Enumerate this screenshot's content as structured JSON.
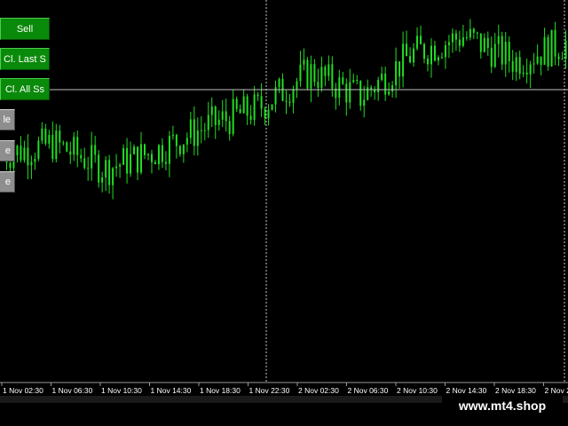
{
  "buttons": {
    "sell_label": "Sell",
    "close_last_label": "Cl. Last S",
    "close_all_label": "Cl. All Ss",
    "grey_1_label": "le",
    "grey_2_label": "e",
    "grey_3_label": "e"
  },
  "time_axis": {
    "labels": [
      "1 Nov 02:30",
      "1 Nov 06:30",
      "1 Nov 10:30",
      "1 Nov 14:30",
      "1 Nov 18:30",
      "1 Nov 22:30",
      "2 Nov 02:30",
      "2 Nov 06:30",
      "2 Nov 10:30",
      "2 Nov 14:30",
      "2 Nov 18:30",
      "2 Nov 2"
    ]
  },
  "watermark": "www.mt4.shop",
  "colors": {
    "background": "#000000",
    "candle": "#22dd22",
    "grid": "#c0c0c0",
    "button_green": "#0a8a0a",
    "button_grey": "#8e8e8e",
    "text": "#ffffff"
  },
  "chart_data": {
    "type": "line",
    "x_labels": [
      "1 Nov 02:30",
      "1 Nov 06:30",
      "1 Nov 10:30",
      "1 Nov 14:30",
      "1 Nov 18:30",
      "1 Nov 22:30",
      "2 Nov 02:30",
      "2 Nov 06:30",
      "2 Nov 10:30",
      "2 Nov 14:30",
      "2 Nov 18:30",
      "2 Nov 2"
    ],
    "series": [
      {
        "values": [
          62,
          65,
          58,
          63,
          70,
          75,
          85,
          78,
          90,
          95,
          88,
          93
        ]
      }
    ],
    "ylim": [
      0,
      100
    ],
    "grid": false
  }
}
